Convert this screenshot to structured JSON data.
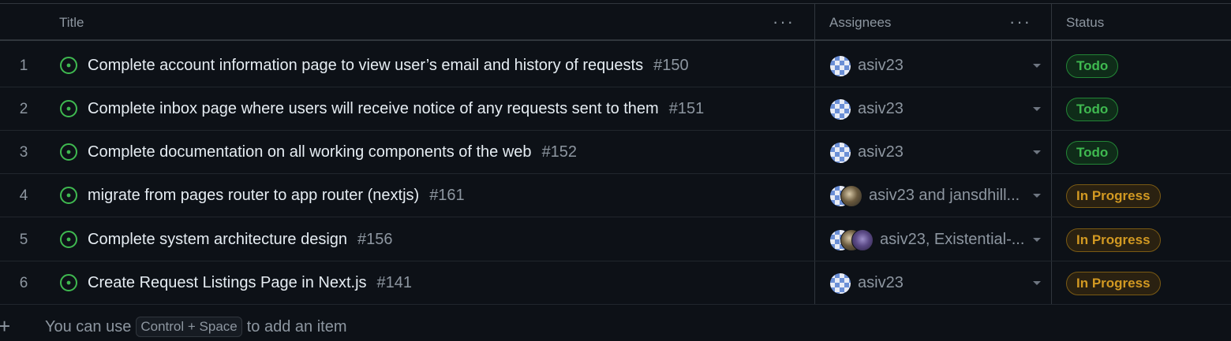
{
  "header": {
    "title_label": "Title",
    "assignees_label": "Assignees",
    "status_label": "Status",
    "menu_glyph": "···"
  },
  "rows": [
    {
      "num": "1",
      "title": "Complete account information page to view user’s email and history of requests",
      "issue": "#150",
      "assignees": "asiv23",
      "status": "Todo"
    },
    {
      "num": "2",
      "title": "Complete inbox page where users will receive notice of any requests sent to them",
      "issue": "#151",
      "assignees": "asiv23",
      "status": "Todo"
    },
    {
      "num": "3",
      "title": "Complete documentation on all working components of the web",
      "issue": "#152",
      "assignees": "asiv23",
      "status": "Todo"
    },
    {
      "num": "4",
      "title": "migrate from pages router to app router (nextjs)",
      "issue": "#161",
      "assignees": "asiv23 and jansdhill...",
      "status": "In Progress"
    },
    {
      "num": "5",
      "title": "Complete system architecture design",
      "issue": "#156",
      "assignees": "asiv23, Existential-...",
      "status": "In Progress"
    },
    {
      "num": "6",
      "title": "Create Request Listings Page in Next.js",
      "issue": "#141",
      "assignees": "asiv23",
      "status": "In Progress"
    }
  ],
  "add_item": {
    "plus": "+",
    "prefix": "You can use",
    "shortcut": "Control + Space",
    "suffix": "to add an item"
  },
  "icons": {
    "issue": "issue-opened-icon",
    "caret": "chevron-down-icon"
  },
  "colors": {
    "background": "#0d1117",
    "open_issue_green": "#3fb950",
    "todo_green": "#3fb950",
    "in_progress_orange": "#d29922",
    "muted_text": "#8d96a0"
  }
}
